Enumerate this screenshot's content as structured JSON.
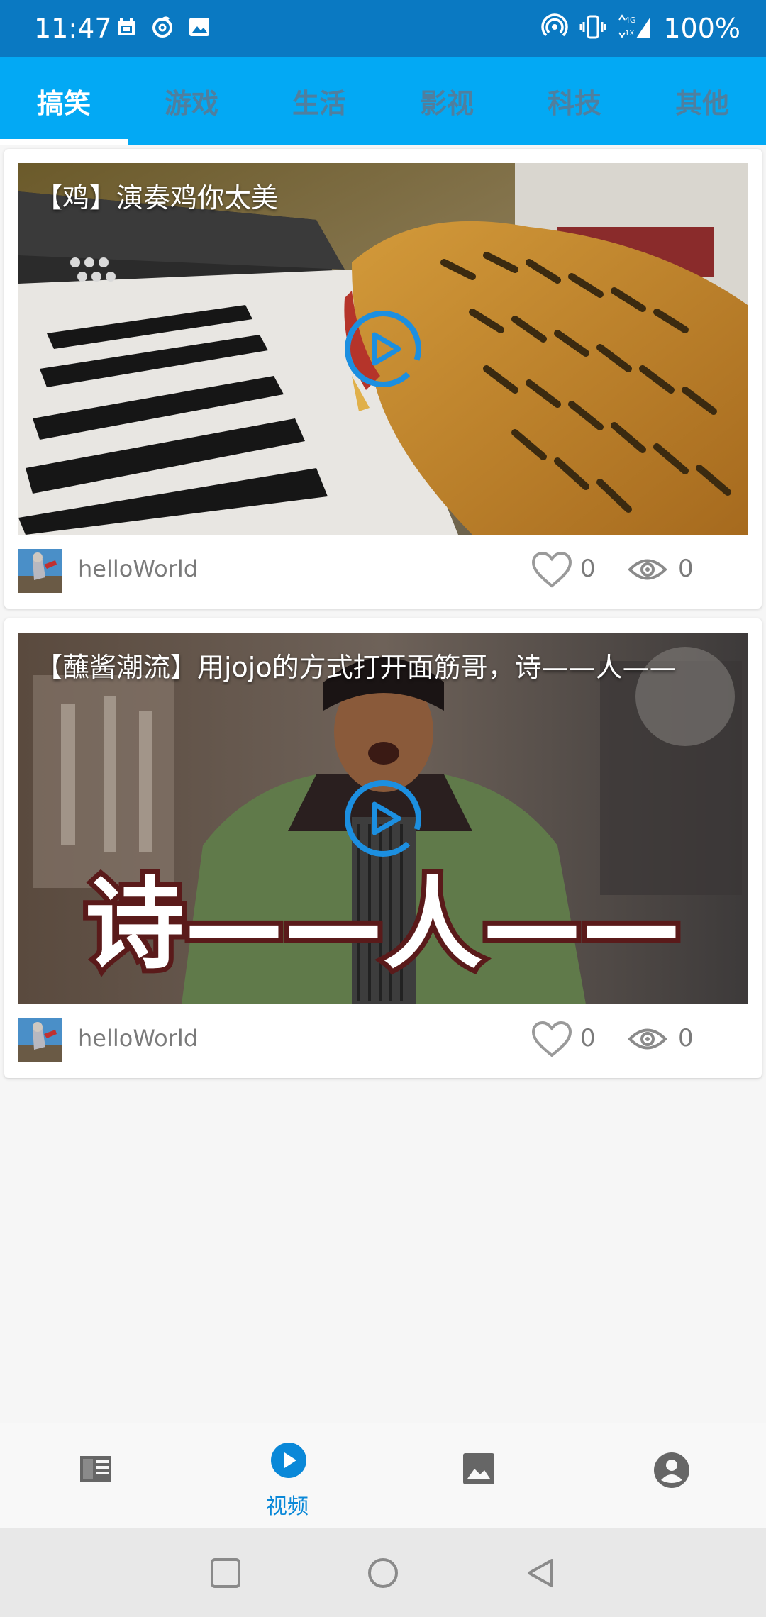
{
  "status_bar": {
    "time": "11:47",
    "battery": "100%",
    "network": "4G",
    "sim_slot": "1X",
    "left_icons": [
      "calendar-icon",
      "netease-music-icon",
      "image-icon"
    ],
    "right_icons": [
      "hotspot-icon",
      "vibrate-icon",
      "signal-icon"
    ]
  },
  "tabs": [
    {
      "label": "搞笑",
      "active": true
    },
    {
      "label": "游戏",
      "active": false
    },
    {
      "label": "生活",
      "active": false
    },
    {
      "label": "影视",
      "active": false
    },
    {
      "label": "科技",
      "active": false
    },
    {
      "label": "其他",
      "active": false
    }
  ],
  "videos": [
    {
      "title": "【鸡】演奏鸡你太美",
      "author": "helloWorld",
      "likes": "0",
      "views": "0"
    },
    {
      "title": "【蘸酱潮流】用jojo的方式打开面筋哥，诗——人——",
      "author": "helloWorld",
      "likes": "0",
      "views": "0",
      "overlay_caption": "诗——人——"
    }
  ],
  "bottom_nav": [
    {
      "icon": "news-icon",
      "label": "",
      "active": false
    },
    {
      "icon": "video-play-icon",
      "label": "视频",
      "active": true
    },
    {
      "icon": "image-icon",
      "label": "",
      "active": false
    },
    {
      "icon": "account-icon",
      "label": "",
      "active": false
    }
  ],
  "colors": {
    "status_bar": "#0a79c2",
    "tab_bar": "#03a9f4",
    "active_nav": "#0a88d8",
    "play_button": "#1c8fe0"
  }
}
